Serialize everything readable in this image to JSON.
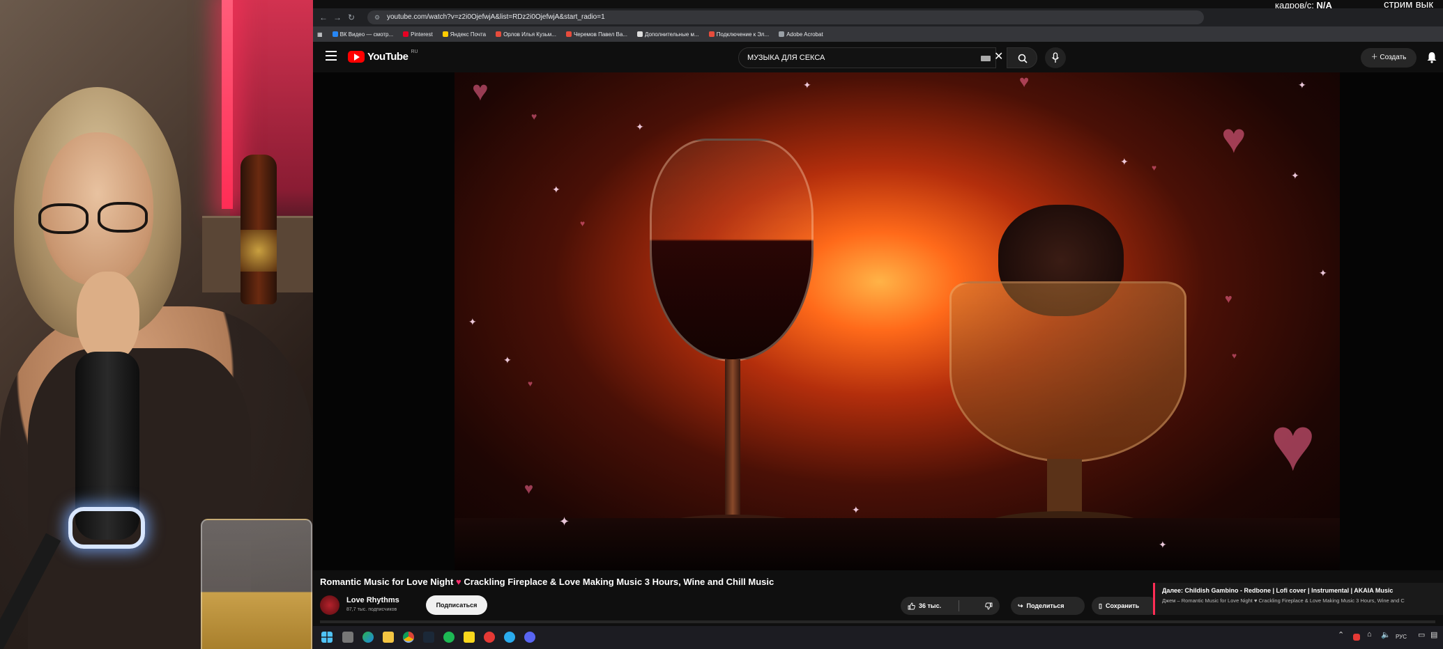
{
  "browser": {
    "url": "youtube.com/watch?v=z2i0OjefwjA&list=RDz2i0OjefwjA&start_radio=1",
    "bookmarks": [
      {
        "label": "ВК Видео — смотр...",
        "color": "#2787f5"
      },
      {
        "label": "Pinterest",
        "color": "#e60023"
      },
      {
        "label": "Яндекс Почта",
        "color": "#ffcc00"
      },
      {
        "label": "Орлов Илья Кузьм...",
        "color": "#e74c3c"
      },
      {
        "label": "Черемов Павел Ва...",
        "color": "#e74c3c"
      },
      {
        "label": "Дополнительные м...",
        "color": "#dddddd"
      },
      {
        "label": "Подключение к Эл...",
        "color": "#e74c3c"
      },
      {
        "label": "Adobe Acrobat",
        "color": "#9aa0a6"
      }
    ]
  },
  "overlay": {
    "fps_label": "кадров/с:",
    "fps_value": "N/A",
    "stream_text": "стрим вык"
  },
  "youtube": {
    "logo_text": "YouTube",
    "logo_region": "RU",
    "search_query": "МУЗЫКА ДЛЯ СЕКСА",
    "create_label": "Создать",
    "video_title_part1": "Romantic Music for Love Night",
    "video_title_heart": "♥",
    "video_title_part2": "Crackling Fireplace & Love Making Music 3 Hours, Wine and Chill Music",
    "channel_name": "Love Rhythms",
    "channel_subs": "87,7 тыс. подписчиков",
    "subscribe_label": "Подписаться",
    "likes": "36 тыс.",
    "share_label": "Поделиться",
    "save_label": "Сохранить",
    "next_up_title": "Далее: Childish Gambino - Redbone | Lofi cover | Instrumental | AKAIA Music",
    "next_up_sub": "Джем – Romantic Music for Love Night ♥ Crackling Fireplace & Love Making Music 3 Hours, Wine and C"
  },
  "taskbar": {
    "lang": "РУС"
  },
  "icons": [
    "hamburger-icon",
    "youtube-logo",
    "keyboard-icon",
    "clear-icon",
    "search-icon",
    "microphone-icon",
    "plus-icon",
    "bell-icon",
    "like-icon",
    "dislike-icon",
    "share-icon",
    "save-icon",
    "more-icon",
    "windows-start-icon"
  ]
}
